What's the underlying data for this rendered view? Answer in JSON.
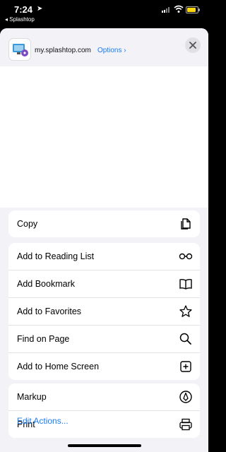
{
  "status_bar": {
    "time": "7:24",
    "back_app": "◂ Splashtop",
    "battery_level": 0.85
  },
  "share_header": {
    "site": "my.splashtop.com",
    "options_label": "Options ›"
  },
  "groups": [
    {
      "items": [
        {
          "label": "Copy",
          "icon": "copy-icon"
        }
      ]
    },
    {
      "items": [
        {
          "label": "Add to Reading List",
          "icon": "glasses-icon"
        },
        {
          "label": "Add Bookmark",
          "icon": "book-icon"
        },
        {
          "label": "Add to Favorites",
          "icon": "star-icon"
        },
        {
          "label": "Find on Page",
          "icon": "search-icon"
        },
        {
          "label": "Add to Home Screen",
          "icon": "add-square-icon"
        }
      ]
    },
    {
      "items": [
        {
          "label": "Markup",
          "icon": "markup-icon"
        },
        {
          "label": "Print",
          "icon": "printer-icon"
        }
      ]
    }
  ],
  "footer": {
    "edit_actions": "Edit Actions..."
  },
  "colors": {
    "accent": "#1a7cf5",
    "sheet_bg": "#f2f2f7",
    "battery": "#ffd60a"
  }
}
